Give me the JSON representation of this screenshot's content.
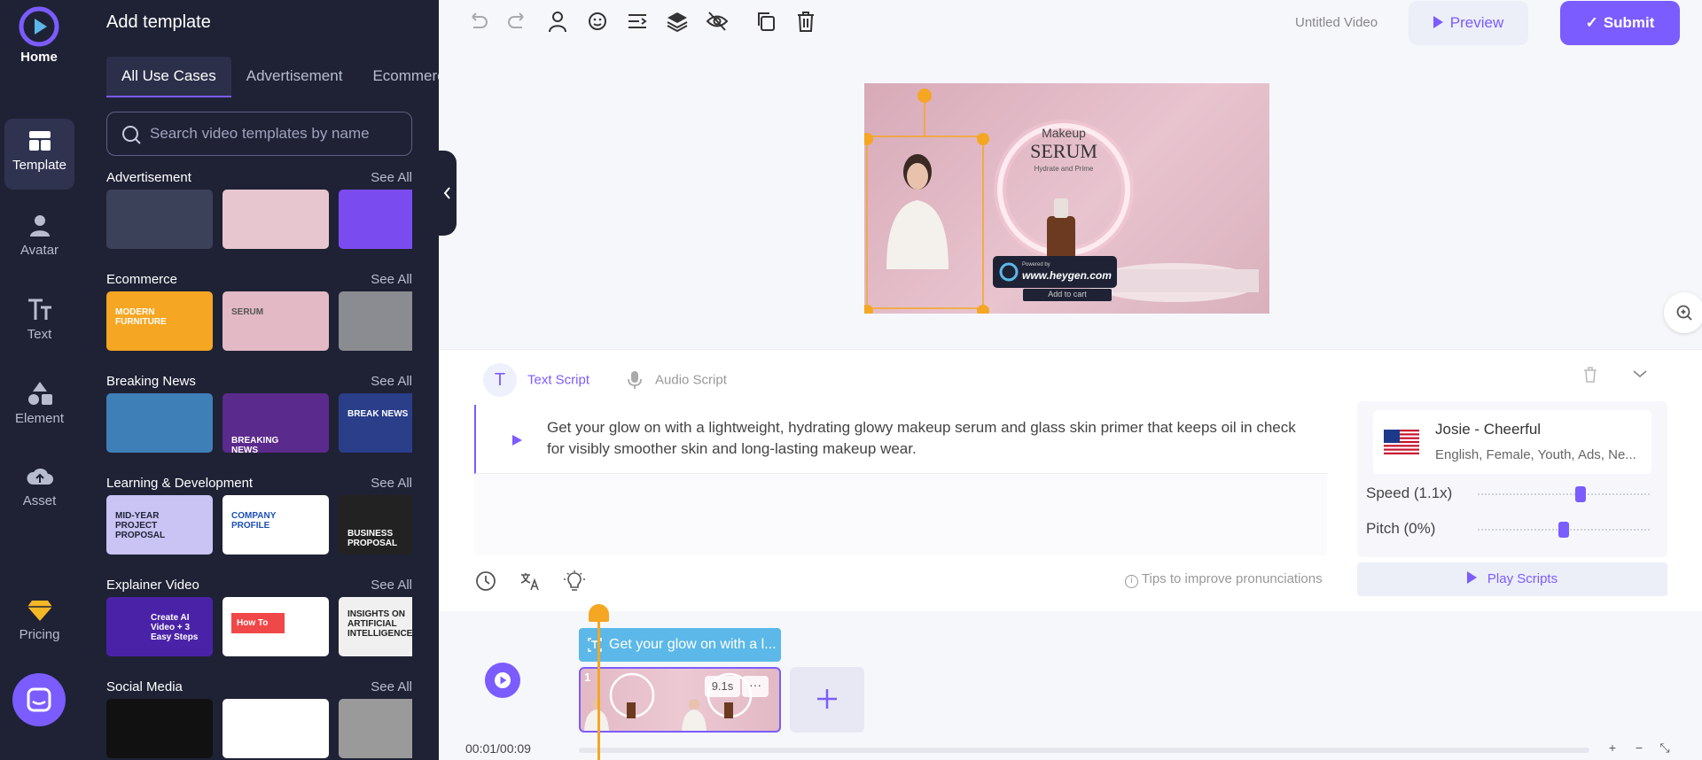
{
  "nav": {
    "home": "Home",
    "items": [
      {
        "label": "Template",
        "icon": "template-icon"
      },
      {
        "label": "Avatar",
        "icon": "avatar-icon"
      },
      {
        "label": "Text",
        "icon": "text-icon"
      },
      {
        "label": "Element",
        "icon": "element-icon"
      },
      {
        "label": "Asset",
        "icon": "asset-icon"
      },
      {
        "label": "Pricing",
        "icon": "pricing-icon"
      }
    ]
  },
  "panel": {
    "title": "Add template",
    "tabs": [
      "All Use Cases",
      "Advertisement",
      "Ecommerce"
    ],
    "search_placeholder": "Search video templates by name",
    "see_all": "See All",
    "sections": [
      {
        "title": "Advertisement",
        "thumbs": [
          {
            "caption": ""
          },
          {
            "caption": ""
          },
          {
            "caption": ""
          }
        ]
      },
      {
        "title": "Ecommerce",
        "thumbs": [
          {
            "caption": "MODERN FURNITURE"
          },
          {
            "caption": "SERUM"
          },
          {
            "caption": ""
          }
        ]
      },
      {
        "title": "Breaking News",
        "thumbs": [
          {
            "caption": ""
          },
          {
            "caption": "BREAKING NEWS"
          },
          {
            "caption": "BREAK NEWS"
          }
        ]
      },
      {
        "title": "Learning & Development",
        "thumbs": [
          {
            "caption": "MID-YEAR PROJECT PROPOSAL"
          },
          {
            "caption": "COMPANY PROFILE"
          },
          {
            "caption": "BUSINESS PROPOSAL"
          }
        ]
      },
      {
        "title": "Explainer Video",
        "thumbs": [
          {
            "caption": "Create AI Video + 3 Easy Steps"
          },
          {
            "caption": "How To"
          },
          {
            "caption": "INSIGHTS ON ARTIFICIAL INTELLIGENCE"
          }
        ]
      },
      {
        "title": "Social Media",
        "thumbs": [
          {
            "caption": ""
          },
          {
            "caption": ""
          },
          {
            "caption": ""
          }
        ]
      }
    ]
  },
  "header": {
    "video_title": "Untitled Video",
    "preview": "Preview",
    "submit": "Submit"
  },
  "canvas": {
    "product_line1": "Makeup",
    "product_line2": "SERUM",
    "product_line3": "Hydrate and Prime",
    "cart_label": "Add to cart",
    "watermark_small": "Powered by",
    "watermark": "www.heygen.com"
  },
  "script": {
    "tab_text": "Text Script",
    "tab_audio": "Audio Script",
    "text": "Get your glow on with a lightweight, hydrating glowy makeup serum and glass skin primer that keeps oil in check for visibly smoother skin and long-lasting makeup wear.",
    "tips": "Tips to improve pronunciations",
    "play_scripts": "Play Scripts"
  },
  "voice": {
    "name": "Josie - Cheerful",
    "details": "English, Female, Youth, Ads, Ne...",
    "speed_label": "Speed (1.1x)",
    "speed_value": 1.1,
    "pitch_label": "Pitch (0%)",
    "pitch_value": 0
  },
  "timeline": {
    "caption": "Get your glow on with a l...",
    "clip_number": "1",
    "clip_duration": "9.1s",
    "time": "00:01/00:09"
  },
  "colors": {
    "accent": "#7b5cff",
    "sidebar": "#1f2235",
    "playhead": "#f5a623",
    "caption": "#5cb8e8"
  }
}
